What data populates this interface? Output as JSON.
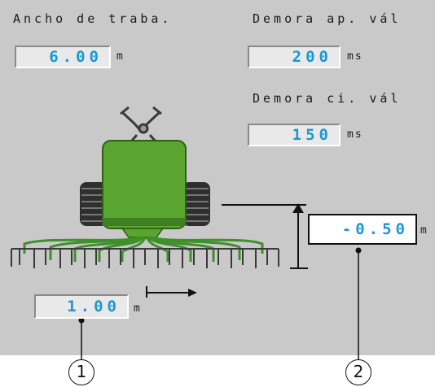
{
  "fields": {
    "working_width": {
      "label": "Ancho de traba.",
      "value": "6.00",
      "unit": "m"
    },
    "valve_open_delay": {
      "label": "Demora ap. vál",
      "value": "200",
      "unit": "ms"
    },
    "valve_close_delay": {
      "label": "Demora ci. vál",
      "value": "150",
      "unit": "ms"
    },
    "height_offset": {
      "value": "-0.50",
      "unit": "m"
    },
    "lateral_offset": {
      "value": "1.00",
      "unit": "m"
    }
  },
  "callouts": [
    "1",
    "2"
  ],
  "colors": {
    "screen_bg": "#c9c9c9",
    "value_text": "#1a97d4",
    "machine_green": "#5aa52f",
    "tines_green": "#3f8f2a"
  }
}
